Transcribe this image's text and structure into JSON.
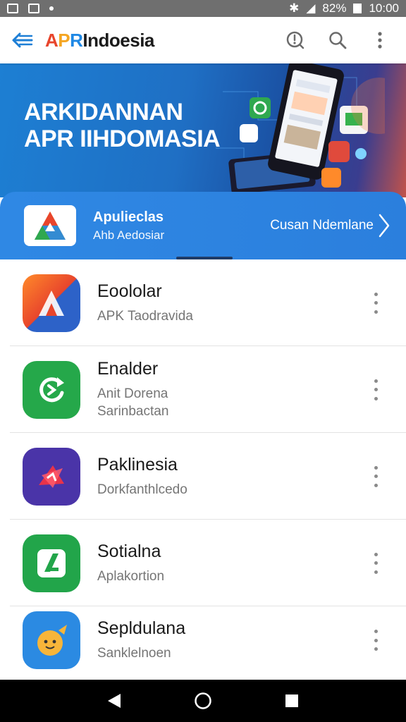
{
  "status_bar": {
    "battery": "82%",
    "time": "10:00"
  },
  "app_bar": {
    "logo_a": "A",
    "logo_p": "P",
    "logo_r": "R",
    "logo_rest": "Indoesia"
  },
  "hero": {
    "line1": "ARKIDANNAN",
    "line2": "APR IIHDOMASIA"
  },
  "featured": {
    "title": "Apulieclas",
    "subtitle": "Ahb Aedosiar",
    "link": "Cusan Ndemlane"
  },
  "apps": [
    {
      "title": "Eoololar",
      "subtitle": "APK Taodravida",
      "icon": "arrow-app-icon",
      "color": "#e8452c"
    },
    {
      "title": "Enalder",
      "subtitle": "Anit Dorena Sarinbactan",
      "icon": "refresh-app-icon",
      "color": "#25a84a"
    },
    {
      "title": "Paklinesia",
      "subtitle": "Dorkfanthlcedo",
      "icon": "star-app-icon",
      "color": "#4a34a8"
    },
    {
      "title": "Sotialna",
      "subtitle": "Aplakortion",
      "icon": "leaf-app-icon",
      "color": "#22a54a"
    },
    {
      "title": "Sepldulana",
      "subtitle": "Sanklelnoen",
      "icon": "mascot-app-icon",
      "color": "#2b8ae2"
    }
  ]
}
